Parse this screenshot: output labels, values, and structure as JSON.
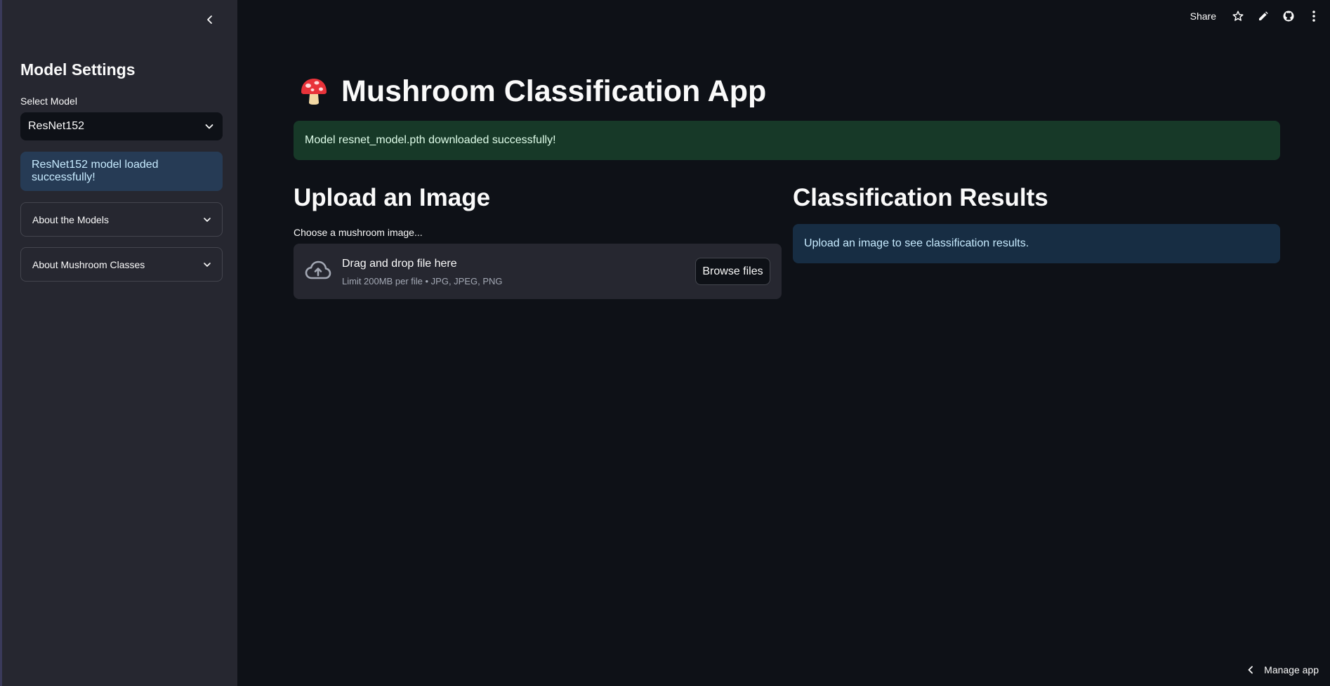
{
  "sidebar": {
    "title": "Model Settings",
    "select_label": "Select Model",
    "selected_model": "ResNet152",
    "status_message": "ResNet152 model loaded successfully!",
    "expanders": [
      {
        "label": "About the Models"
      },
      {
        "label": "About Mushroom Classes"
      }
    ]
  },
  "toolbar": {
    "share_label": "Share",
    "icons": [
      "star-icon",
      "pencil-icon",
      "github-icon",
      "more-vert-icon"
    ]
  },
  "main": {
    "title_emoji": "🍄",
    "title": "Mushroom Classification App",
    "download_message": "Model resnet_model.pth downloaded successfully!",
    "upload": {
      "heading": "Upload an Image",
      "label": "Choose a mushroom image...",
      "drop_title": "Drag and drop file here",
      "drop_subtitle": "Limit 200MB per file • JPG, JPEG, PNG",
      "browse_label": "Browse files"
    },
    "results": {
      "heading": "Classification Results",
      "info_message": "Upload an image to see classification results."
    }
  },
  "footer": {
    "manage_label": "Manage app"
  },
  "colors": {
    "background": "#0e1117",
    "sidebar": "#262730",
    "success_bg": "#173928",
    "info_bg": "#172d43",
    "sidebar_info_bg": "#263b55"
  }
}
